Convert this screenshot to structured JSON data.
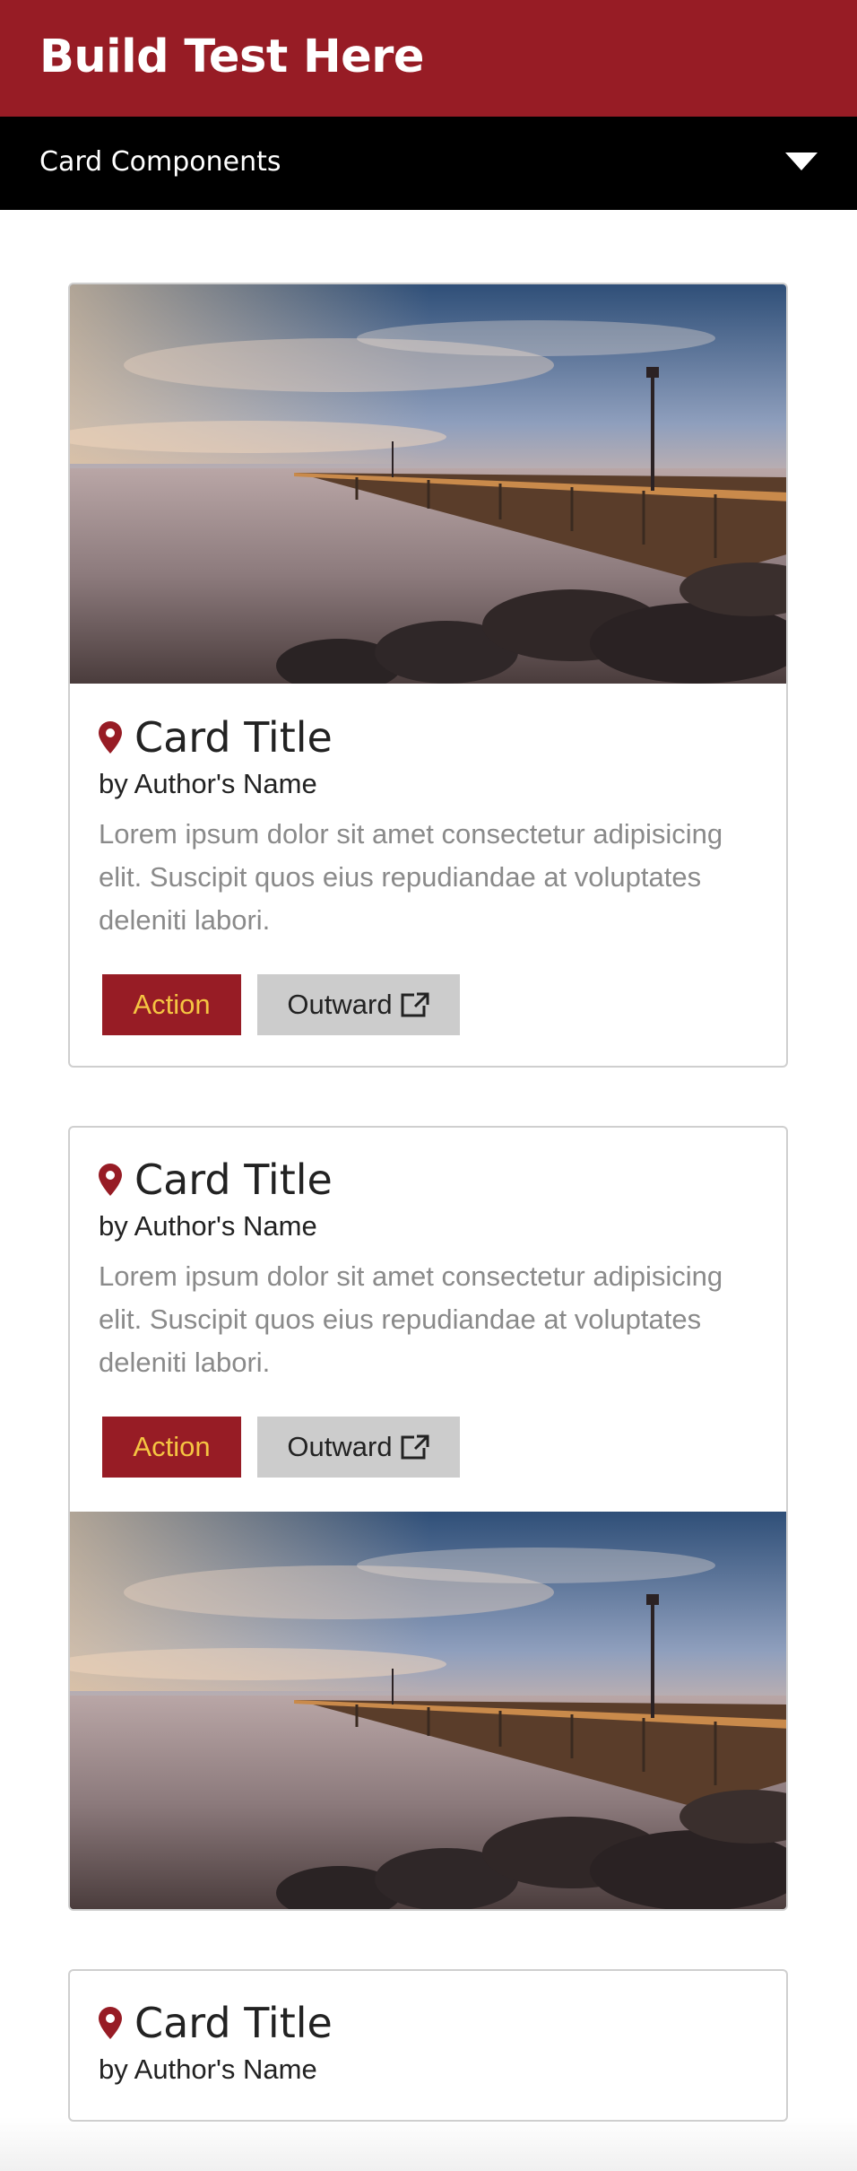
{
  "header": {
    "title": "Build Test Here"
  },
  "nav": {
    "label": "Card Components"
  },
  "cards": [
    {
      "title": "Card Title",
      "author": "by Author's Name",
      "text": "Lorem ipsum dolor sit amet consectetur adipisicing elit. Suscipit quos eius repudiandae at voluptates deleniti labori.",
      "action_label": "Action",
      "outward_label": "Outward"
    },
    {
      "title": "Card Title",
      "author": "by Author's Name",
      "text": "Lorem ipsum dolor sit amet consectetur adipisicing elit. Suscipit quos eius repudiandae at voluptates deleniti labori.",
      "action_label": "Action",
      "outward_label": "Outward"
    },
    {
      "title": "Card Title",
      "author": "by Author's Name"
    }
  ],
  "colors": {
    "brand": "#971c25",
    "action_text": "#f5c542",
    "outward_bg": "#cccccc",
    "nav_bg": "#000000"
  },
  "icons": {
    "pin": "map-pin-icon",
    "external": "external-link-icon",
    "dropdown": "chevron-down-icon"
  }
}
